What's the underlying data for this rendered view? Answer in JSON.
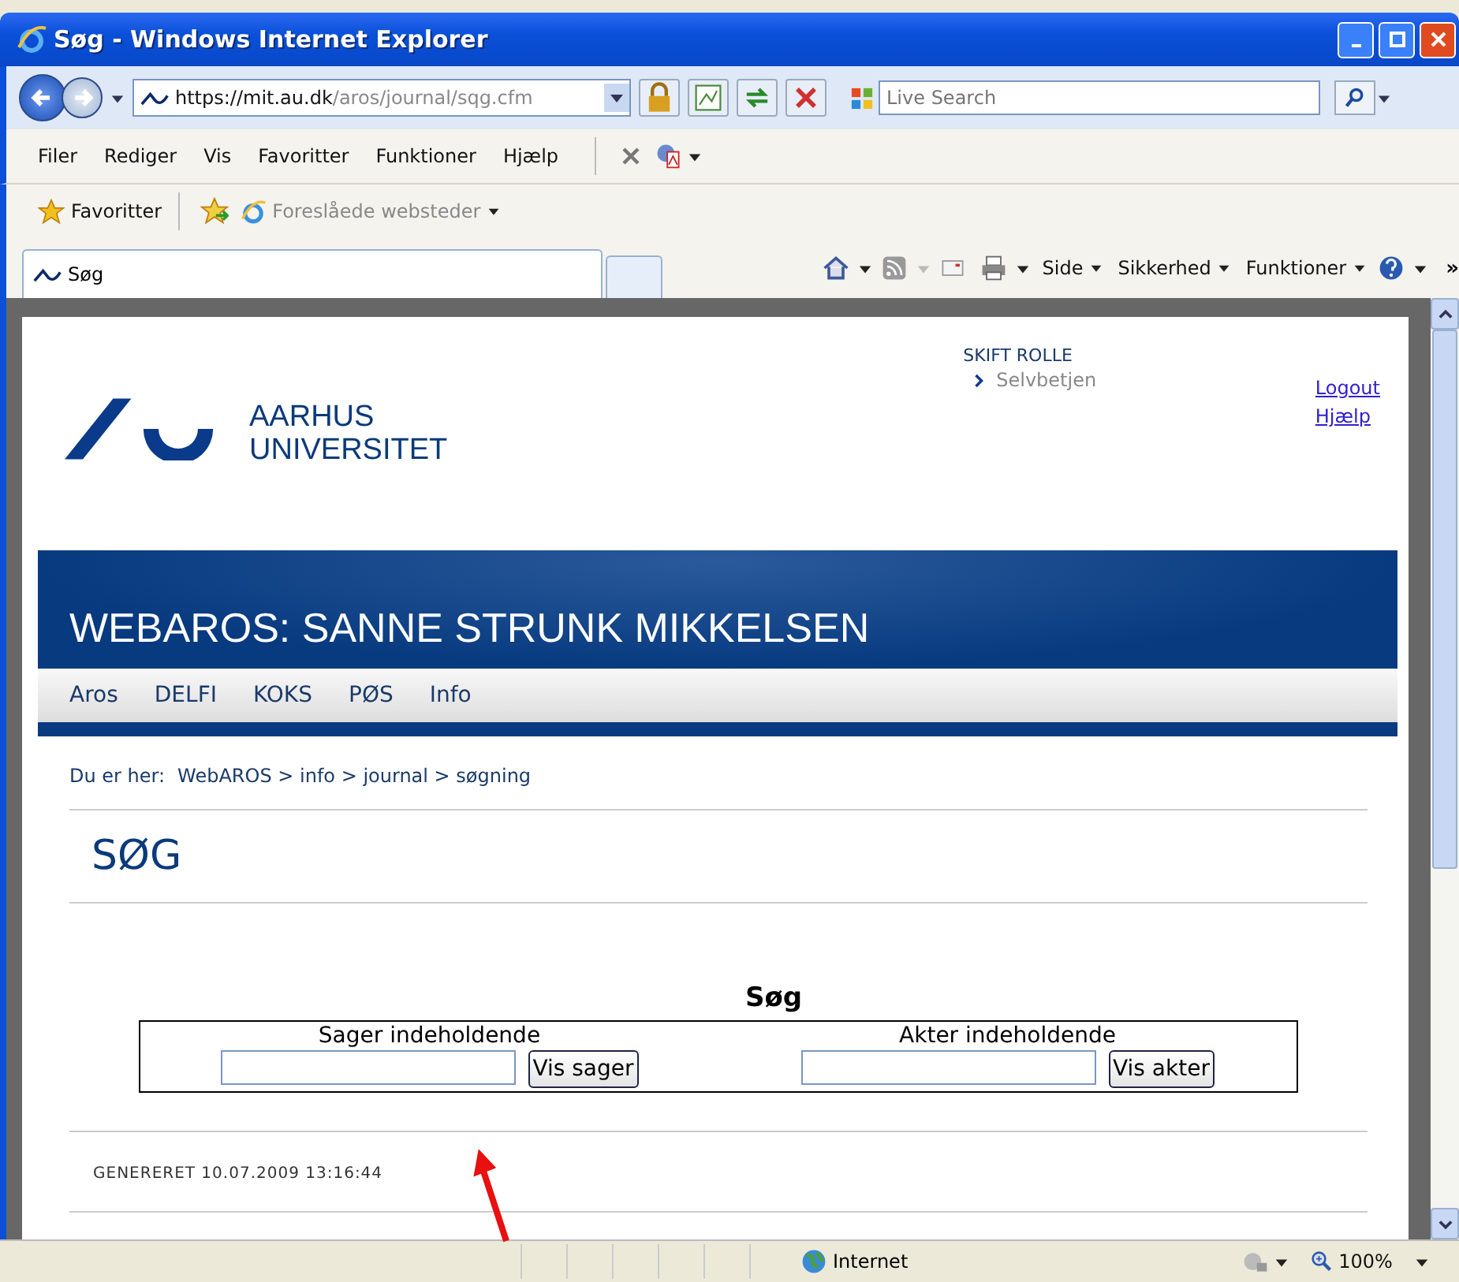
{
  "window": {
    "title": "Søg - Windows Internet Explorer"
  },
  "address": {
    "url_host": "https://mit.au.dk",
    "url_path": "/aros/journal/sqg.cfm"
  },
  "search": {
    "placeholder": "Live Search"
  },
  "menu": [
    "Filer",
    "Rediger",
    "Vis",
    "Favoritter",
    "Funktioner",
    "Hjælp"
  ],
  "favorites_bar": {
    "favorites": "Favoritter",
    "suggested": "Foreslåede websteder"
  },
  "tabs": [
    {
      "label": "Søg",
      "selected": true
    }
  ],
  "command_bar": {
    "items": [
      "Side",
      "Sikkerhed",
      "Funktioner"
    ],
    "overflow": "»"
  },
  "page": {
    "logo_lines": [
      "AARHUS",
      "UNIVERSITET"
    ],
    "role": {
      "heading": "SKIFT ROLLE",
      "item": "Selvbetjen"
    },
    "links": [
      "Logout",
      "Hjælp"
    ],
    "banner_title": "WEBAROS: SANNE STRUNK MIKKELSEN",
    "nav": [
      "Aros",
      "DELFI",
      "KOKS",
      "PØS",
      "Info"
    ],
    "breadcrumb": {
      "label": "Du er her:",
      "trail": "WebAROS > info > journal > søgning"
    },
    "heading": "SØG",
    "search_form": {
      "title": "Søg",
      "fields": [
        {
          "label": "Sager indeholdende",
          "button": "Vis sager"
        },
        {
          "label": "Akter indeholdende",
          "button": "Vis akter"
        }
      ]
    },
    "generated": "GENERERET 10.07.2009 13:16:44"
  },
  "status_bar": {
    "zone": "Internet",
    "zoom": "100%"
  }
}
